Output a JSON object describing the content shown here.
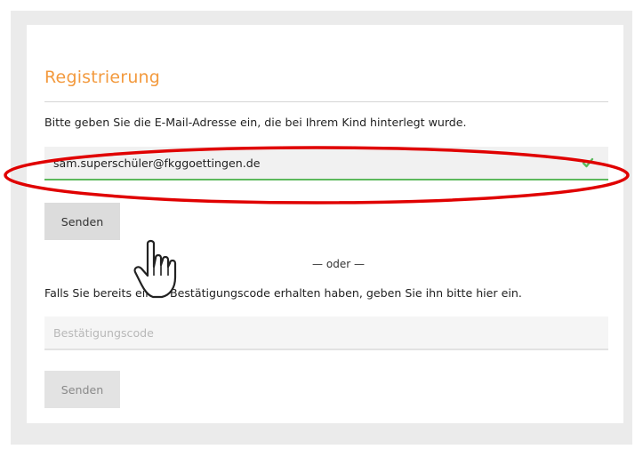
{
  "form": {
    "title": "Registrierung",
    "instruction": "Bitte geben Sie die E-Mail-Adresse ein, die bei Ihrem Kind hinterlegt wurde.",
    "email_value": "sam.superschüler@fkggoettingen.de",
    "email_status_icon": "checkmark-icon",
    "send_label": "Senden",
    "divider_text": "— oder —",
    "code_instruction": "Falls Sie bereits einen Bestätigungscode erhalten haben, geben Sie ihn bitte hier ein.",
    "code_placeholder": "Bestätigungscode",
    "code_send_label": "Senden"
  },
  "colors": {
    "title": "#f39a3e",
    "valid_underline": "#5cb85c",
    "annotation": "#e00000"
  },
  "annotations": {
    "highlight": "red-ellipse",
    "cursor": "hand-pointer-icon"
  }
}
